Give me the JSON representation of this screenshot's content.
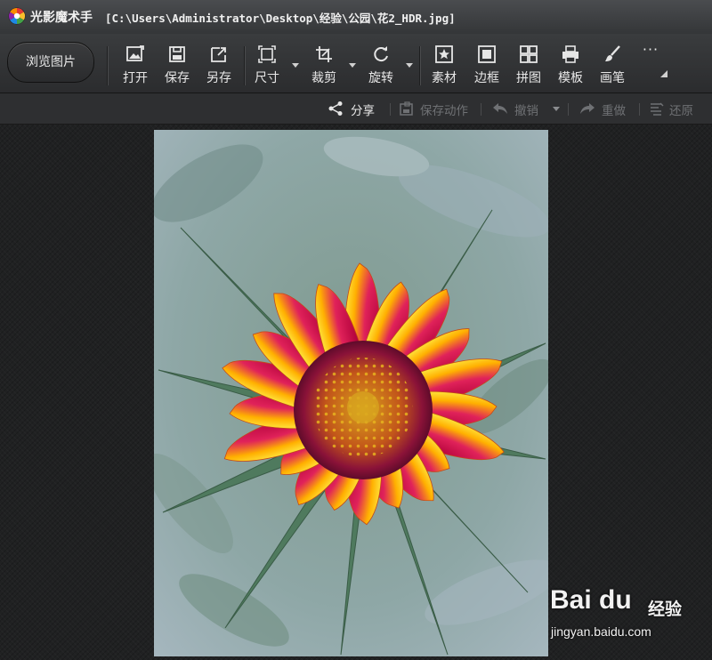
{
  "window": {
    "app_name": "光影魔术手",
    "file_path": "[C:\\Users\\Administrator\\Desktop\\经验\\公园\\花2_HDR.jpg]"
  },
  "toolbar": {
    "browse_label": "浏览图片",
    "tools": [
      {
        "label": "打开",
        "icon": "open-image-icon"
      },
      {
        "label": "保存",
        "icon": "save-disk-icon"
      },
      {
        "label": "另存",
        "icon": "save-as-icon"
      },
      {
        "label": "尺寸",
        "icon": "resize-icon"
      },
      {
        "label": "裁剪",
        "icon": "crop-icon"
      },
      {
        "label": "旋转",
        "icon": "rotate-icon"
      },
      {
        "label": "素材",
        "icon": "star-material-icon"
      },
      {
        "label": "边框",
        "icon": "frame-icon"
      },
      {
        "label": "拼图",
        "icon": "collage-grid-icon"
      },
      {
        "label": "模板",
        "icon": "printer-template-icon"
      },
      {
        "label": "画笔",
        "icon": "brush-icon"
      }
    ],
    "more_label": "···"
  },
  "actions": {
    "share": "分享",
    "save_action": "保存动作",
    "undo": "撤销",
    "redo": "重做",
    "restore": "还原"
  },
  "watermark": {
    "logo": "Bai du",
    "jingyan": "经验",
    "url": "jingyan.baidu.com"
  },
  "colors": {
    "accent_text": "#e8e8e8",
    "disabled_text": "#6f7174",
    "background": "#232425"
  }
}
